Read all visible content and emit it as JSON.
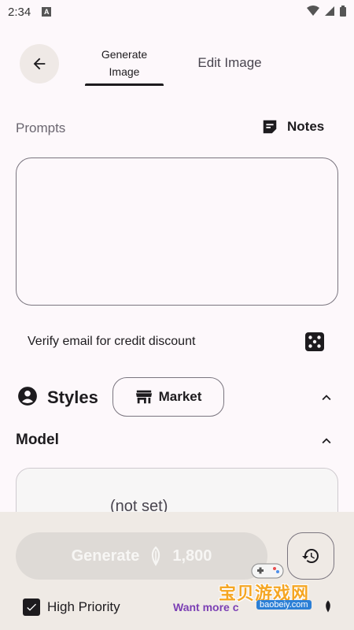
{
  "status": {
    "time": "2:34",
    "notification_badge": "A"
  },
  "header": {
    "tabs": [
      {
        "label": "Generate Image",
        "active": true
      },
      {
        "label": "Edit Image",
        "active": false
      }
    ]
  },
  "prompts": {
    "label": "Prompts",
    "notes_label": "Notes",
    "value": ""
  },
  "verify": {
    "text": "Verify email for credit discount"
  },
  "styles": {
    "label": "Styles",
    "market_label": "Market"
  },
  "model": {
    "label": "Model",
    "value": "(not set)"
  },
  "generate": {
    "label": "Generate",
    "cost": "1,800"
  },
  "priority": {
    "label": "High Priority",
    "checked": true
  },
  "upsell": {
    "text": "Want more c"
  },
  "watermark": {
    "text": "宝贝游戏网",
    "url": "baobeiy.com"
  },
  "colors": {
    "background": "#fdf8fb",
    "bottom_panel": "#efeae5",
    "generate_disabled": "#dedad6",
    "accent_purple": "#7b3fb4"
  }
}
